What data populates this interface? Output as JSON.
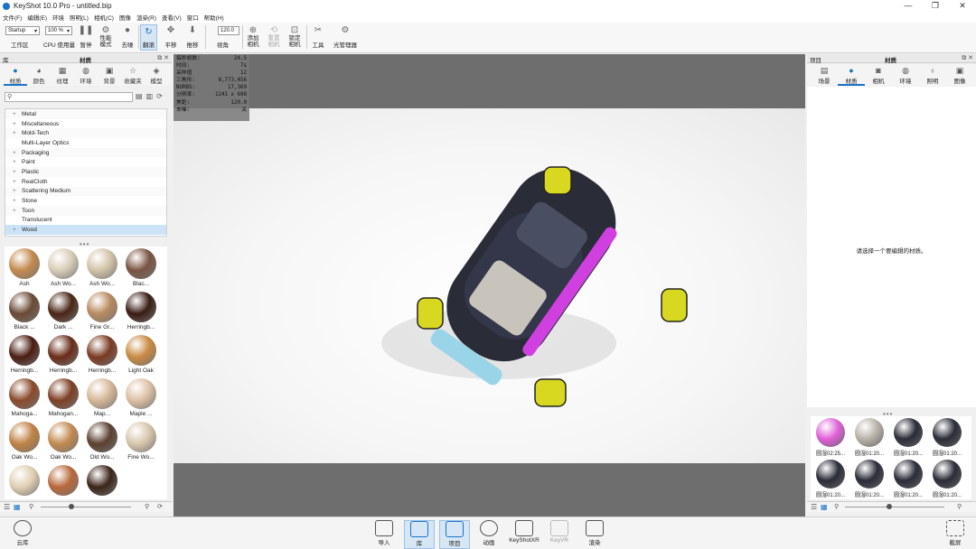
{
  "window": {
    "title": "KeyShot 10.0 Pro  - untitled.bip",
    "minimize": "—",
    "maximize": "❐",
    "close": "✕"
  },
  "menu": [
    "文件(F)",
    "编辑(E)",
    "环境",
    "照明(L)",
    "相机(C)",
    "图像",
    "渲染(R)",
    "查看(V)",
    "窗口",
    "帮助(H)"
  ],
  "toolbar": {
    "workspace_select": "Startup",
    "workspace_label": "工作区",
    "cpu_select": "100 %",
    "cpu_label": "CPU 使用量",
    "pause": "暂停",
    "perf_mode": "性能模式",
    "denoise": "去噪",
    "tumble": "翻滚",
    "pan": "平移",
    "dolly": "推移",
    "fov_value": "120.0",
    "fov_label": "视角",
    "add_camera": "添加相机",
    "reset_camera": "重置相机",
    "lock_camera": "锁定相机",
    "tools": "工具",
    "light_manager": "光管理器"
  },
  "left_panel": {
    "header_left": "库",
    "header_center": "材质",
    "tabs": [
      {
        "label": "材质",
        "icon": "sphere-icon"
      },
      {
        "label": "颜色",
        "icon": "palette-icon"
      },
      {
        "label": "纹理",
        "icon": "texture-icon"
      },
      {
        "label": "环境",
        "icon": "environment-icon"
      },
      {
        "label": "背景",
        "icon": "image-icon"
      },
      {
        "label": "收藏夹",
        "icon": "star-icon"
      },
      {
        "label": "模型",
        "icon": "cube-icon"
      }
    ],
    "search_placeholder": "",
    "tree": [
      {
        "label": "Metal",
        "expand": "+"
      },
      {
        "label": "Miscellaneous",
        "expand": "+"
      },
      {
        "label": "Mold-Tech",
        "expand": "+"
      },
      {
        "label": "Multi-Layer Optics",
        "expand": ""
      },
      {
        "label": "Packaging",
        "expand": "+"
      },
      {
        "label": "Paint",
        "expand": "+"
      },
      {
        "label": "Plastic",
        "expand": "+"
      },
      {
        "label": "RealCloth",
        "expand": "+"
      },
      {
        "label": "Scattering Medium",
        "expand": "+"
      },
      {
        "label": "Stone",
        "expand": "+"
      },
      {
        "label": "Toon",
        "expand": "+"
      },
      {
        "label": "Translucent",
        "expand": ""
      },
      {
        "label": "Wood",
        "expand": "+"
      }
    ],
    "materials": [
      {
        "label": "Ash",
        "color": "#c48a4e"
      },
      {
        "label": "Ash Wo...",
        "color": "#d8cdb8"
      },
      {
        "label": "Ash Wo...",
        "color": "#d2c3a8"
      },
      {
        "label": "Blac...",
        "color": "#7a5442"
      },
      {
        "label": "Black ...",
        "color": "#6b4a36"
      },
      {
        "label": "Dark ...",
        "color": "#4a2616"
      },
      {
        "label": "Fine Gr...",
        "color": "#b88a60"
      },
      {
        "label": "Herringb...",
        "color": "#3a1c14"
      },
      {
        "label": "Herringb...",
        "color": "#4a1d12"
      },
      {
        "label": "Herringb...",
        "color": "#6a2c1a"
      },
      {
        "label": "Herringb...",
        "color": "#7a3a22"
      },
      {
        "label": "Light Oak",
        "color": "#c88a42"
      },
      {
        "label": "Mahoga...",
        "color": "#8a4a2c"
      },
      {
        "label": "Mahogan...",
        "color": "#7c4024"
      },
      {
        "label": "Map...",
        "color": "#d6b89a"
      },
      {
        "label": "Maple ...",
        "color": "#dcc0a4"
      },
      {
        "label": "Oak Wo...",
        "color": "#bf8244"
      },
      {
        "label": "Oak Wo...",
        "color": "#c28a50"
      },
      {
        "label": "Old Wo...",
        "color": "#5a4030"
      },
      {
        "label": "Fine Wo...",
        "color": "#d8c6ac"
      },
      {
        "label": "",
        "color": "#e0cfb2"
      },
      {
        "label": "",
        "color": "#b8683a"
      },
      {
        "label": "",
        "color": "#3c2418"
      }
    ]
  },
  "viewport": {
    "stats": [
      {
        "label": "每秒帧数:",
        "value": "24.5"
      },
      {
        "label": "时间:",
        "value": "7s"
      },
      {
        "label": "采样值",
        "value": "12"
      },
      {
        "label": "三角形:",
        "value": "8,773,456"
      },
      {
        "label": "NURBS:",
        "value": "17,369"
      },
      {
        "label": "分辨率:",
        "value": "1241 x 698"
      },
      {
        "label": "焦距:",
        "value": "120.0"
      },
      {
        "label": "去噪:",
        "value": "关"
      }
    ]
  },
  "right_panel": {
    "header_left": "项目",
    "header_center": "材质",
    "tabs": [
      {
        "label": "场景",
        "icon": "scene-icon"
      },
      {
        "label": "材质",
        "icon": "sphere-icon"
      },
      {
        "label": "相机",
        "icon": "camera-icon"
      },
      {
        "label": "环境",
        "icon": "environment-icon"
      },
      {
        "label": "照明",
        "icon": "bulb-icon"
      },
      {
        "label": "图像",
        "icon": "image-icon"
      }
    ],
    "message": "请选择一个要编辑的材质。",
    "materials": [
      {
        "label": "圆湿02:25...",
        "color": "#e060d8"
      },
      {
        "label": "圆湿01:20...",
        "color": "#b8b2a8"
      },
      {
        "label": "圆湿01:20...",
        "color": "#2a2c38"
      },
      {
        "label": "圆湿01:20...",
        "color": "#2a2c38"
      },
      {
        "label": "圆湿01:20...",
        "color": "#2a2c38"
      },
      {
        "label": "圆湿01:20...",
        "color": "#2a2c38"
      },
      {
        "label": "圆湿01:20...",
        "color": "#2a2c38"
      },
      {
        "label": "圆湿01:20...",
        "color": "#2a2c38"
      }
    ]
  },
  "bottombar": {
    "cloud": "云库",
    "import": "导入",
    "library": "库",
    "project": "项目",
    "animation": "动画",
    "keyshotxr": "KeyShotXR",
    "keyvr": "KeyVR",
    "render": "渲染",
    "screenshot": "截屏"
  }
}
